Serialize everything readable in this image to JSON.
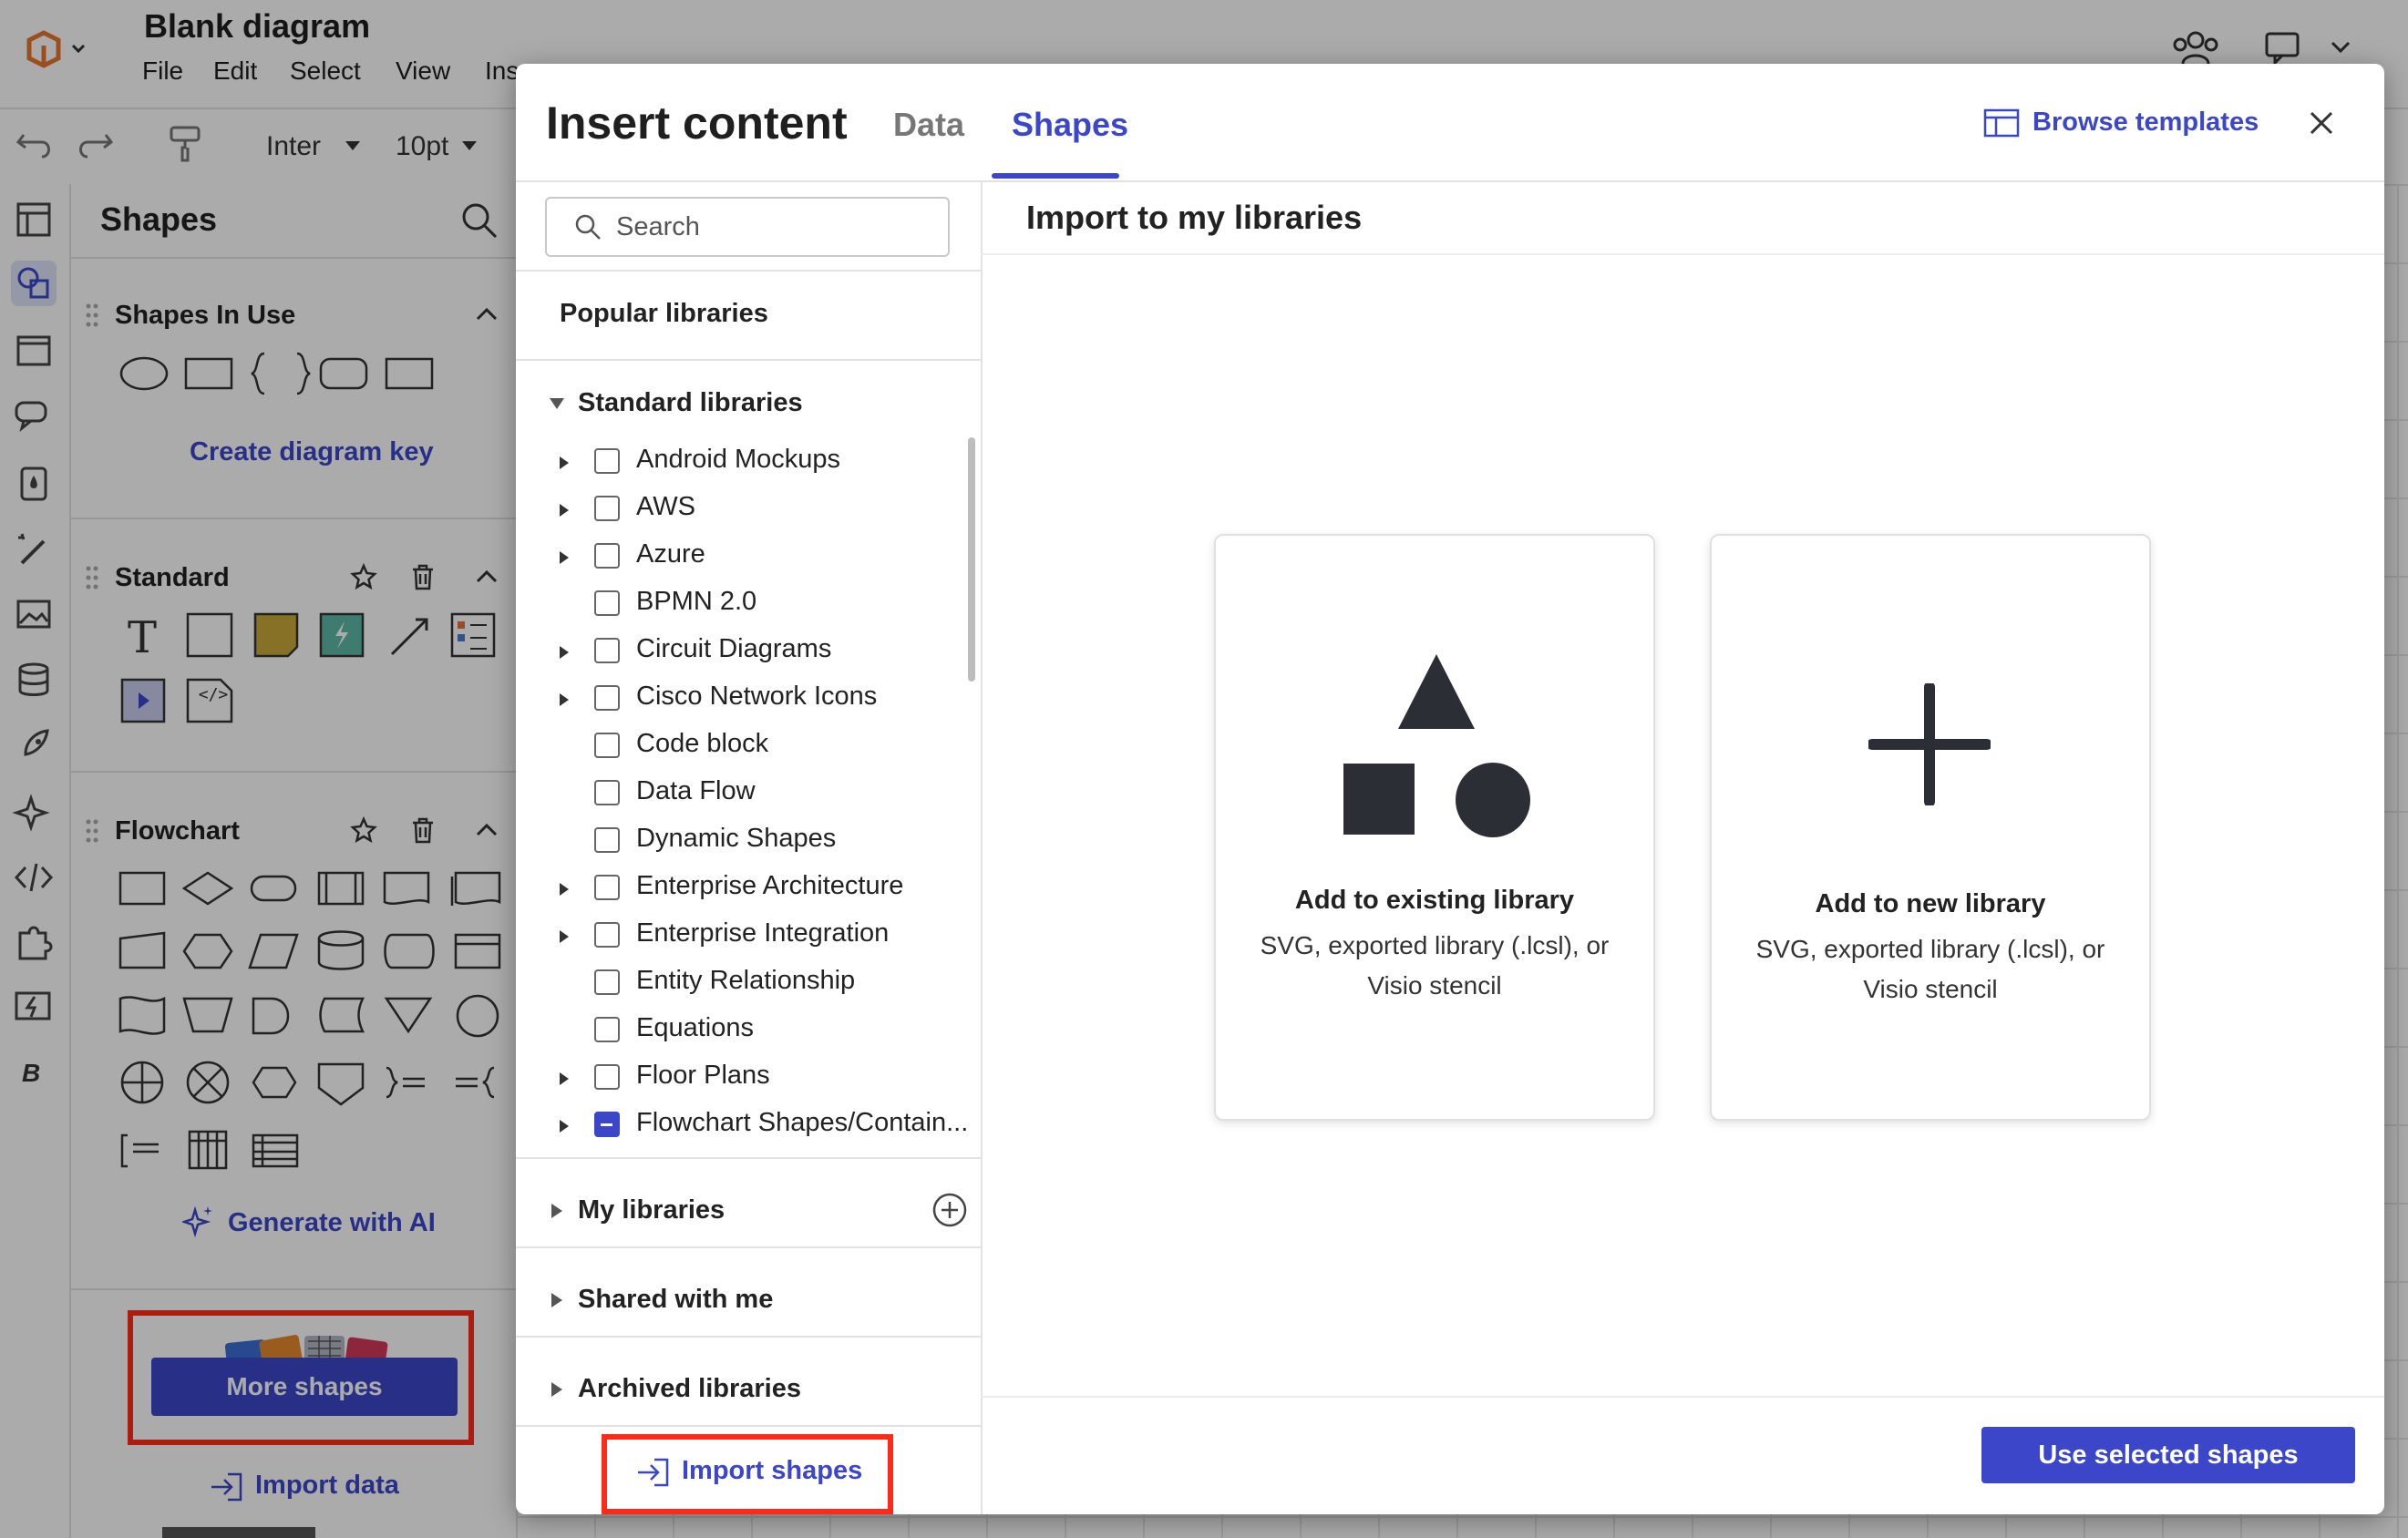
{
  "app": {
    "doc_title": "Blank diagram",
    "menu": [
      "File",
      "Edit",
      "Select",
      "View",
      "Ins"
    ],
    "toolbar": {
      "font": "Inter",
      "size": "10pt"
    }
  },
  "shapes_panel": {
    "title": "Shapes",
    "sections": {
      "in_use": {
        "title": "Shapes In Use",
        "link": "Create diagram key"
      },
      "standard": {
        "title": "Standard"
      },
      "flowchart": {
        "title": "Flowchart",
        "link": "Generate with AI"
      }
    },
    "more_shapes": "More shapes",
    "import_data": "Import data"
  },
  "modal": {
    "title": "Insert content",
    "tabs": [
      {
        "label": "Data",
        "active": false
      },
      {
        "label": "Shapes",
        "active": true
      }
    ],
    "browse_templates": "Browse templates",
    "search": {
      "placeholder": "Search",
      "value": ""
    },
    "popular": "Popular libraries",
    "standard_libraries": {
      "title": "Standard libraries",
      "items": [
        {
          "label": "Android Mockups",
          "expandable": true,
          "state": "unchecked"
        },
        {
          "label": "AWS",
          "expandable": true,
          "state": "unchecked"
        },
        {
          "label": "Azure",
          "expandable": true,
          "state": "unchecked"
        },
        {
          "label": "BPMN 2.0",
          "expandable": false,
          "state": "unchecked"
        },
        {
          "label": "Circuit Diagrams",
          "expandable": true,
          "state": "unchecked"
        },
        {
          "label": "Cisco Network Icons",
          "expandable": true,
          "state": "unchecked"
        },
        {
          "label": "Code block",
          "expandable": false,
          "state": "unchecked"
        },
        {
          "label": "Data Flow",
          "expandable": false,
          "state": "unchecked"
        },
        {
          "label": "Dynamic Shapes",
          "expandable": false,
          "state": "unchecked"
        },
        {
          "label": "Enterprise Architecture",
          "expandable": true,
          "state": "unchecked"
        },
        {
          "label": "Enterprise Integration",
          "expandable": true,
          "state": "unchecked"
        },
        {
          "label": "Entity Relationship",
          "expandable": false,
          "state": "unchecked"
        },
        {
          "label": "Equations",
          "expandable": false,
          "state": "unchecked"
        },
        {
          "label": "Floor Plans",
          "expandable": true,
          "state": "unchecked"
        },
        {
          "label": "Flowchart Shapes/Contain...",
          "expandable": true,
          "state": "mixed"
        }
      ]
    },
    "my_libraries": "My libraries",
    "shared_with_me": "Shared with me",
    "archived": "Archived libraries",
    "import_shapes": "Import shapes",
    "main": {
      "title": "Import to my libraries",
      "cards": [
        {
          "title": "Add to existing library",
          "desc_line1": "SVG, exported library (.lcsl), or",
          "desc_line2": "Visio stencil"
        },
        {
          "title": "Add to new library",
          "desc_line1": "SVG, exported library (.lcsl), or",
          "desc_line2": "Visio stencil"
        }
      ]
    },
    "use_selected": "Use selected shapes"
  },
  "colors": {
    "accent": "#3b46c8",
    "highlight": "#ff2a1a"
  }
}
